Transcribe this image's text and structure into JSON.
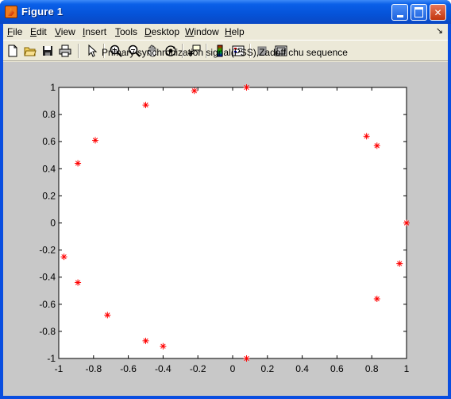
{
  "window": {
    "title": "Figure 1",
    "close_glyph": "✕"
  },
  "menu": {
    "items": [
      {
        "label": "File",
        "accel": "F"
      },
      {
        "label": "Edit",
        "accel": "E"
      },
      {
        "label": "View",
        "accel": "V"
      },
      {
        "label": "Insert",
        "accel": "I"
      },
      {
        "label": "Tools",
        "accel": "T"
      },
      {
        "label": "Desktop",
        "accel": "D"
      },
      {
        "label": "Window",
        "accel": "W"
      },
      {
        "label": "Help",
        "accel": "H"
      }
    ],
    "dock_glyph": "↘"
  },
  "toolbar": {
    "icons": [
      "new-figure-icon",
      "open-file-icon",
      "save-icon",
      "print-icon",
      "edit-plot-arrow-icon",
      "zoom-in-icon",
      "zoom-out-icon",
      "pan-hand-icon",
      "rotate-3d-icon",
      "data-cursor-icon",
      "insert-colorbar-icon",
      "insert-legend-icon",
      "hide-plot-tools-icon",
      "show-plot-tools-icon"
    ]
  },
  "chart_data": {
    "type": "scatter",
    "title": "Primary synchronization signal(PSS),Zadoff chu sequence",
    "xlabel": "",
    "ylabel": "",
    "xlim": [
      -1,
      1
    ],
    "ylim": [
      -1,
      1
    ],
    "xticks": [
      "-1",
      "-0.8",
      "-0.6",
      "-0.4",
      "-0.2",
      "0",
      "0.2",
      "0.4",
      "0.6",
      "0.8",
      "1"
    ],
    "yticks": [
      "-1",
      "-0.8",
      "-0.6",
      "-0.4",
      "-0.2",
      "0",
      "0.2",
      "0.4",
      "0.6",
      "0.8",
      "1"
    ],
    "grid": false,
    "marker": "*",
    "marker_color": "#ff0000",
    "points": [
      {
        "x": 0.08,
        "y": 1.0
      },
      {
        "x": -0.22,
        "y": 0.975
      },
      {
        "x": -0.5,
        "y": 0.87
      },
      {
        "x": -0.79,
        "y": 0.61
      },
      {
        "x": -0.89,
        "y": 0.44
      },
      {
        "x": 0.77,
        "y": 0.64
      },
      {
        "x": 0.83,
        "y": 0.57
      },
      {
        "x": 1.0,
        "y": 0.0
      },
      {
        "x": -0.97,
        "y": -0.25
      },
      {
        "x": -0.89,
        "y": -0.44
      },
      {
        "x": 0.96,
        "y": -0.3
      },
      {
        "x": 0.83,
        "y": -0.56
      },
      {
        "x": -0.72,
        "y": -0.68
      },
      {
        "x": -0.5,
        "y": -0.87
      },
      {
        "x": -0.4,
        "y": -0.91
      },
      {
        "x": 0.08,
        "y": -1.0
      }
    ]
  }
}
